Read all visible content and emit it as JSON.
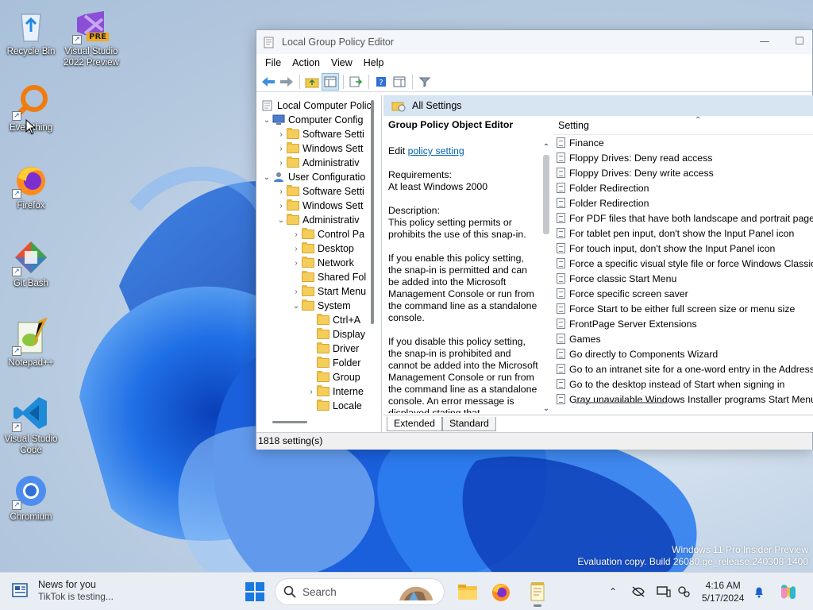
{
  "desktop": {
    "icons": [
      {
        "label": "Recycle Bin"
      },
      {
        "label": "Visual Studio 2022 Preview",
        "badge": "PRE"
      },
      {
        "label": "Everything"
      },
      {
        "label": "Firefox"
      },
      {
        "label": "Git Bash"
      },
      {
        "label": "Notepad++"
      },
      {
        "label": "Visual Studio Code"
      },
      {
        "label": "Chromium"
      }
    ]
  },
  "window": {
    "title": "Local Group Policy Editor",
    "menu": [
      "File",
      "Action",
      "View",
      "Help"
    ],
    "tree": [
      {
        "label": "Local Computer Polic"
      },
      {
        "label": "Computer Config"
      },
      {
        "label": "Software Setti"
      },
      {
        "label": "Windows Sett"
      },
      {
        "label": "Administrativ"
      },
      {
        "label": "User Configuratio"
      },
      {
        "label": "Software Setti"
      },
      {
        "label": "Windows Sett"
      },
      {
        "label": "Administrativ"
      },
      {
        "label": "Control Pa"
      },
      {
        "label": "Desktop"
      },
      {
        "label": "Network"
      },
      {
        "label": "Shared Fol"
      },
      {
        "label": "Start Menu"
      },
      {
        "label": "System"
      },
      {
        "label": "Ctrl+A"
      },
      {
        "label": "Display"
      },
      {
        "label": "Driver"
      },
      {
        "label": "Folder"
      },
      {
        "label": "Group"
      },
      {
        "label": "Interne"
      },
      {
        "label": "Locale"
      }
    ],
    "pane_header": "All Settings",
    "description": {
      "title": "Group Policy Object Editor",
      "edit_prefix": "Edit",
      "edit_link": "policy setting",
      "requirements_label": "Requirements:",
      "requirements_value": "At least Windows 2000",
      "description_label": "Description:",
      "p1": "This policy setting permits or prohibits the use of this snap-in.",
      "p2": "If you enable this policy setting, the snap-in is permitted and can be added into the Microsoft Management Console or run from the command line as a standalone console.",
      "p3": "If you disable this policy setting, the snap-in is prohibited and cannot be added into the Microsoft Management Console or run from the command line as a standalone console. An error message is displayed stating that"
    },
    "list_header": "Setting",
    "settings": [
      "Finance",
      "Floppy Drives: Deny read access",
      "Floppy Drives: Deny write access",
      "Folder Redirection",
      "Folder Redirection",
      "For PDF files that have both landscape and portrait pages,",
      "For tablet pen input, don't show the Input Panel icon",
      "For touch input, don't show the Input Panel icon",
      "Force a specific visual style file or force Windows Classic",
      "Force classic Start Menu",
      "Force specific screen saver",
      "Force Start to be either full screen size or menu size",
      "FrontPage Server Extensions",
      "Games",
      "Go directly to Components Wizard",
      "Go to an intranet site for a one-word entry in the Address b",
      "Go to the desktop instead of Start when signing in",
      "Gray unavailable Windows Installer programs Start Menu s"
    ],
    "tabs": [
      "Extended",
      "Standard"
    ],
    "status": "1818 setting(s)"
  },
  "watermark": {
    "line1": "Windows 11 Pro Insider Preview",
    "line2": "Evaluation copy. Build 26080.ge_release.240308-1400"
  },
  "taskbar": {
    "news_title": "News for you",
    "news_sub": "TikTok is testing...",
    "search_placeholder": "Search",
    "time": "4:16 AM",
    "date": "5/17/2024"
  }
}
